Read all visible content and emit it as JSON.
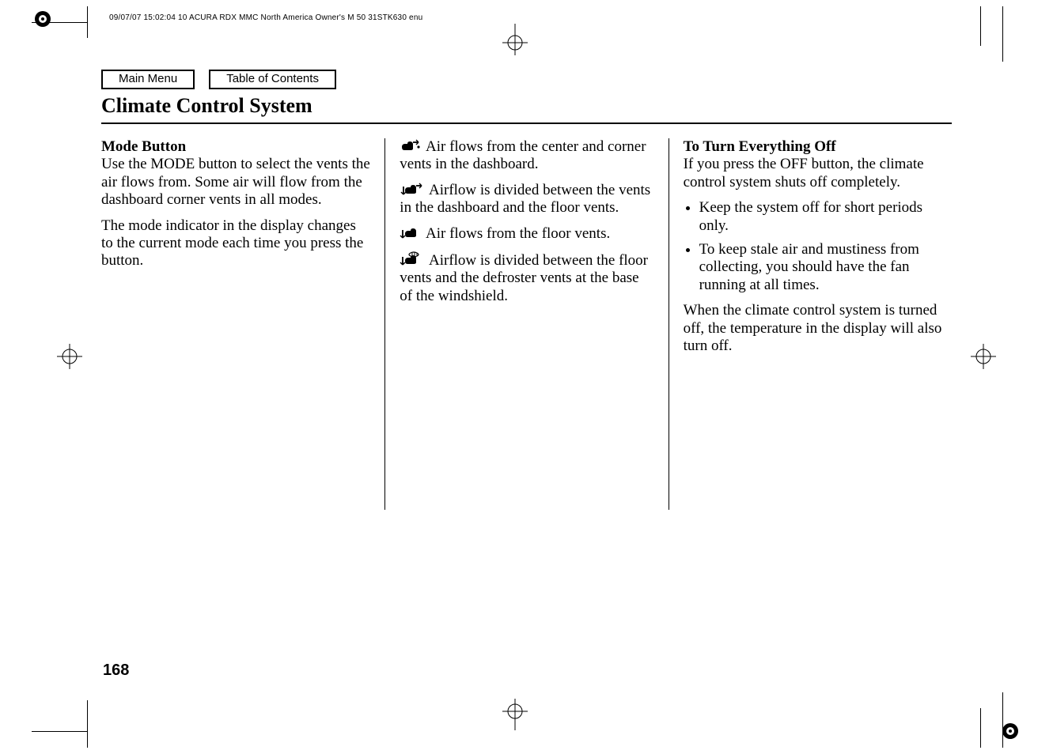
{
  "header_line": "09/07/07 15:02:04   10 ACURA RDX MMC North America Owner's M 50 31STK630 enu",
  "nav": {
    "main_menu": "Main Menu",
    "toc": "Table of Contents"
  },
  "title": "Climate Control System",
  "col1": {
    "heading": "Mode Button",
    "p1": "Use the MODE button to select the vents the air flows from. Some air will flow from the dashboard corner vents in all modes.",
    "p2": "The mode indicator in the display changes to the current mode each time you press the button."
  },
  "col2": {
    "mode1": "Air flows from the center and corner vents in the dashboard.",
    "mode2": "Airflow is divided between the vents in the dashboard and the floor vents.",
    "mode3": "Air flows from the floor vents.",
    "mode4": "Airflow is divided between the floor vents and the defroster vents at the base of the windshield."
  },
  "col3": {
    "heading": "To Turn Everything Off",
    "p1": "If you press the OFF button, the climate control system shuts off completely.",
    "li1": "Keep the system off for short periods only.",
    "li2": "To keep stale air and mustiness from collecting, you should have the fan running at all times.",
    "p2": "When the climate control system is turned off, the temperature in the display will also turn off."
  },
  "page_number": "168"
}
